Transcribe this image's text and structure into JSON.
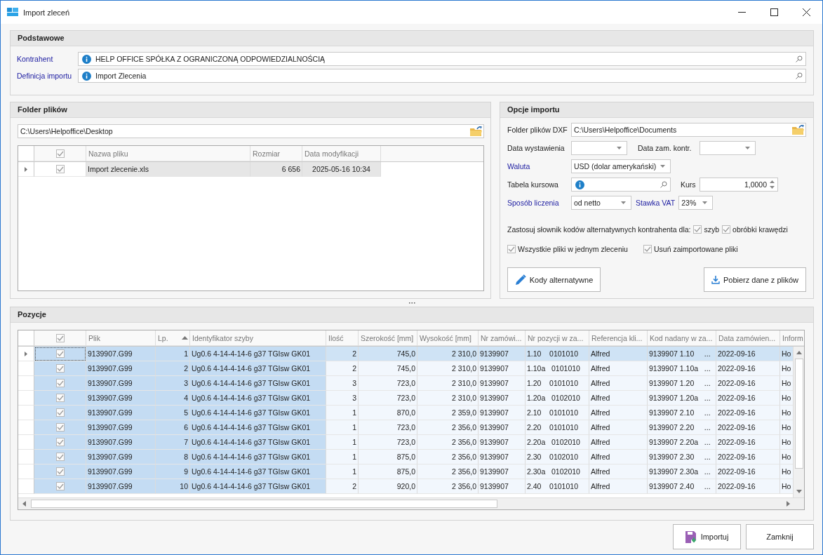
{
  "window": {
    "title": "Import zleceń"
  },
  "podstawowe": {
    "title": "Podstawowe",
    "fields": [
      {
        "label": "Kontrahent",
        "required": true,
        "value": "HELP OFFICE SPÓŁKA Z OGRANICZONĄ ODPOWIEDZIALNOŚCIĄ"
      },
      {
        "label": "Definicja importu",
        "required": true,
        "value": "Import Zlecenia"
      }
    ]
  },
  "folder": {
    "title": "Folder plików",
    "path": "C:\\Users\\Helpoffice\\Desktop",
    "header_checked": true,
    "columns": [
      "Nazwa pliku",
      "Rozmiar",
      "Data modyfikacji"
    ],
    "rows": [
      {
        "selected": true,
        "checked": true,
        "cells": [
          "Import zlecenie.xls",
          "6 656",
          "2025-05-16 10:34"
        ]
      }
    ]
  },
  "opcje": {
    "title": "Opcje importu",
    "folder_dxf": {
      "label": "Folder plików DXF",
      "value": "C:\\Users\\Helpoffice\\Documents"
    },
    "data_wystawienia": {
      "label": "Data wystawienia"
    },
    "data_zam": {
      "label": "Data zam. kontr."
    },
    "waluta": {
      "label": "Waluta",
      "value": "USD (dolar amerykański)"
    },
    "tabela": {
      "label": "Tabela kursowa"
    },
    "kurs": {
      "label": "Kurs",
      "value": "1,0000"
    },
    "sposob": {
      "label": "Sposób liczenia",
      "value": "od netto"
    },
    "vat": {
      "label": "Stawka VAT",
      "value": "23%"
    },
    "slownik_text": "Zastosuj słownik kodów alternatywnych kontrahenta dla:",
    "slownik_checks": [
      {
        "label": "szyb",
        "checked": true
      },
      {
        "label": "obróbki krawędzi",
        "checked": true
      }
    ],
    "checks": [
      {
        "label": "Wszystkie pliki w jednym zleceniu",
        "checked": true
      },
      {
        "label": "Usuń zaimportowane pliki",
        "checked": true
      }
    ],
    "buttons": [
      {
        "label": "Kody alternatywne",
        "kind": "pencil"
      },
      {
        "label": "Pobierz dane z plików",
        "kind": "download"
      }
    ]
  },
  "pozycje": {
    "title": "Pozycje",
    "header_checked": true,
    "columns": [
      {
        "label": "Plik",
        "highlighted": true
      },
      {
        "label": "Lp.",
        "highlighted": true,
        "sorted": true
      },
      {
        "label": "Identyfikator szyby",
        "highlighted": true
      },
      {
        "label": "Ilość",
        "highlighted": false
      },
      {
        "label": "Szerokość [mm]",
        "highlighted": false
      },
      {
        "label": "Wysokość [mm]",
        "highlighted": false
      },
      {
        "label": "Nr zamówi...",
        "highlighted": false
      },
      {
        "label": "Nr pozycji w za...",
        "highlighted": false
      },
      {
        "label": "Referencja kli...",
        "highlighted": false
      },
      {
        "label": "Kod nadany w za...",
        "highlighted": false
      },
      {
        "label": "Data zamówien...",
        "highlighted": false
      },
      {
        "label": "Inform",
        "highlighted": false
      }
    ],
    "rows": [
      {
        "selected": true,
        "checked": true,
        "cells": [
          "9139907.G99",
          "1",
          "Ug0.6 4-14-4-14-6 g37 TGIsw GK01",
          "2",
          "745,0",
          "2 310,0",
          "9139907",
          "1.10    0101010",
          "Alfred",
          "9139907 1.10     ...",
          "2022-09-16",
          "Ho"
        ]
      },
      {
        "selected": false,
        "checked": true,
        "cells": [
          "9139907.G99",
          "2",
          "Ug0.6 4-14-4-14-6 g37 TGIsw GK01",
          "2",
          "745,0",
          "2 310,0",
          "9139907",
          "1.10a   0101010",
          "Alfred",
          "9139907 1.10a   ...",
          "2022-09-16",
          "Ho"
        ]
      },
      {
        "selected": false,
        "checked": true,
        "cells": [
          "9139907.G99",
          "3",
          "Ug0.6 4-14-4-14-6 g37 TGIsw GK01",
          "3",
          "723,0",
          "2 310,0",
          "9139907",
          "1.20    0101010",
          "Alfred",
          "9139907 1.20     ...",
          "2022-09-16",
          "Ho"
        ]
      },
      {
        "selected": false,
        "checked": true,
        "cells": [
          "9139907.G99",
          "4",
          "Ug0.6 4-14-4-14-6 g37 TGIsw GK01",
          "3",
          "723,0",
          "2 310,0",
          "9139907",
          "1.20a   0102010",
          "Alfred",
          "9139907 1.20a   ...",
          "2022-09-16",
          "Ho"
        ]
      },
      {
        "selected": false,
        "checked": true,
        "cells": [
          "9139907.G99",
          "5",
          "Ug0.6 4-14-4-14-6 g37 TGIsw GK01",
          "1",
          "870,0",
          "2 359,0",
          "9139907",
          "2.10    0101010",
          "Alfred",
          "9139907 2.10     ...",
          "2022-09-16",
          "Ho"
        ]
      },
      {
        "selected": false,
        "checked": true,
        "cells": [
          "9139907.G99",
          "6",
          "Ug0.6 4-14-4-14-6 g37 TGIsw GK01",
          "1",
          "723,0",
          "2 356,0",
          "9139907",
          "2.20    0101010",
          "Alfred",
          "9139907 2.20     ...",
          "2022-09-16",
          "Ho"
        ]
      },
      {
        "selected": false,
        "checked": true,
        "cells": [
          "9139907.G99",
          "7",
          "Ug0.6 4-14-4-14-6 g37 TGIsw GK01",
          "1",
          "723,0",
          "2 356,0",
          "9139907",
          "2.20a   0102010",
          "Alfred",
          "9139907 2.20a   ...",
          "2022-09-16",
          "Ho"
        ]
      },
      {
        "selected": false,
        "checked": true,
        "cells": [
          "9139907.G99",
          "8",
          "Ug0.6 4-14-4-14-6 g37 TGIsw GK01",
          "1",
          "875,0",
          "2 356,0",
          "9139907",
          "2.30    0102010",
          "Alfred",
          "9139907 2.30     ...",
          "2022-09-16",
          "Ho"
        ]
      },
      {
        "selected": false,
        "checked": true,
        "cells": [
          "9139907.G99",
          "9",
          "Ug0.6 4-14-4-14-6 g37 TGIsw GK01",
          "1",
          "875,0",
          "2 356,0",
          "9139907",
          "2.30a   0102010",
          "Alfred",
          "9139907 2.30a   ...",
          "2022-09-16",
          "Ho"
        ]
      },
      {
        "selected": false,
        "checked": true,
        "cells": [
          "9139907.G99",
          "10",
          "Ug0.6 4-14-4-14-6 g37 TGIsw GK01",
          "2",
          "920,0",
          "2 356,0",
          "9139907",
          "2.40    0101010",
          "Alfred",
          "9139907 2.40     ...",
          "2022-09-16",
          "Ho"
        ]
      }
    ]
  },
  "footer_buttons": [
    {
      "label": "Importuj",
      "kind": "save"
    },
    {
      "label": "Zamknij",
      "kind": "plain"
    }
  ]
}
